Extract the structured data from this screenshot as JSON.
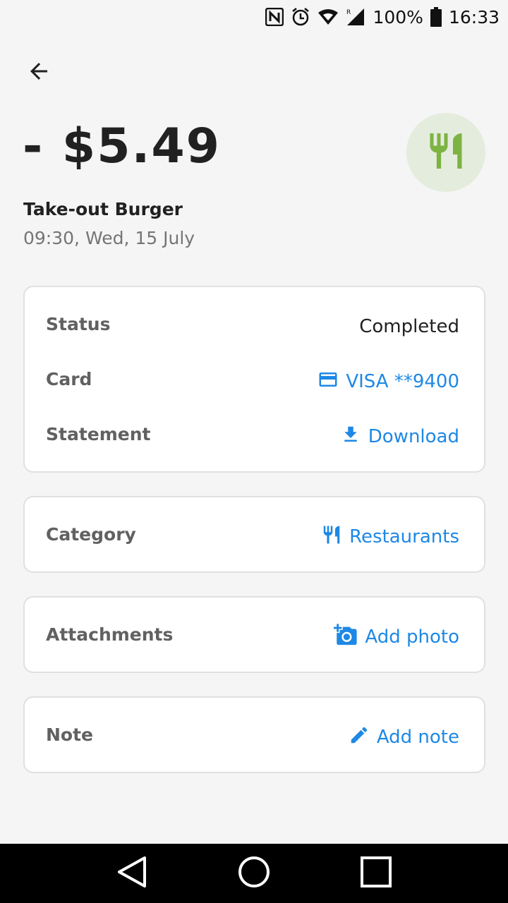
{
  "status_bar": {
    "battery": "100%",
    "time": "16:33",
    "icons": [
      "nfc-icon",
      "alarm-icon",
      "wifi-icon",
      "signal-icon",
      "battery-icon"
    ]
  },
  "transaction": {
    "amount": "- $5.49",
    "merchant": "Take-out Burger",
    "datetime": "09:30, Wed, 15 July",
    "category_icon": "restaurant-icon",
    "category_color": "#7cb342"
  },
  "details": {
    "status_label": "Status",
    "status_value": "Completed",
    "card_label": "Card",
    "card_value": "VISA **9400",
    "statement_label": "Statement",
    "statement_value": "Download"
  },
  "category": {
    "label": "Category",
    "value": "Restaurants"
  },
  "attachments": {
    "label": "Attachments",
    "value": "Add photo"
  },
  "note": {
    "label": "Note",
    "value": "Add note"
  },
  "colors": {
    "accent": "#1e88e5",
    "badge_bg": "#e4ecdd"
  }
}
